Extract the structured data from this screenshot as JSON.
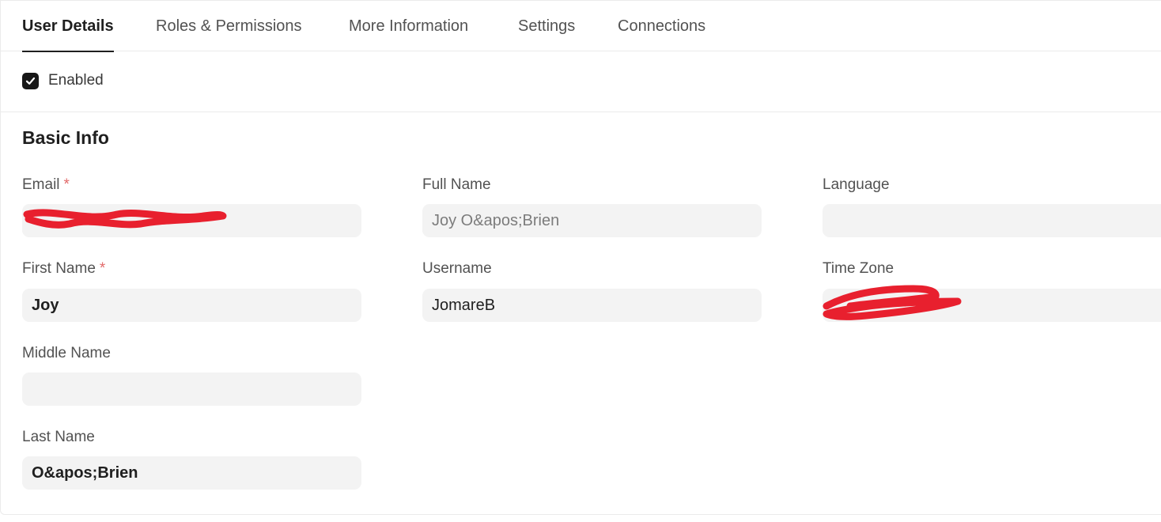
{
  "tabs": [
    {
      "label": "User Details",
      "active": true
    },
    {
      "label": "Roles & Permissions",
      "active": false
    },
    {
      "label": "More Information",
      "active": false
    },
    {
      "label": "Settings",
      "active": false
    },
    {
      "label": "Connections",
      "active": false
    }
  ],
  "enabled": {
    "label": "Enabled",
    "checked": true
  },
  "section": {
    "title": "Basic Info"
  },
  "fields": {
    "email": {
      "label": "Email",
      "required_mark": "*",
      "value": ""
    },
    "full_name": {
      "label": "Full Name",
      "value": "Joy O&apos;Brien"
    },
    "language": {
      "label": "Language",
      "value": ""
    },
    "first_name": {
      "label": "First Name",
      "required_mark": "*",
      "value": "Joy"
    },
    "username": {
      "label": "Username",
      "value": "JomareB"
    },
    "time_zone": {
      "label": "Time Zone",
      "value": ""
    },
    "middle_name": {
      "label": "Middle Name",
      "value": ""
    },
    "last_name": {
      "label": "Last Name",
      "value": "O&apos;Brien"
    }
  },
  "colors": {
    "accent": "#171717",
    "required": "#e26a6a",
    "redaction": "#e8202e",
    "input_bg": "#f3f3f3"
  },
  "icons": {
    "checkbox": "checkmark-icon"
  }
}
